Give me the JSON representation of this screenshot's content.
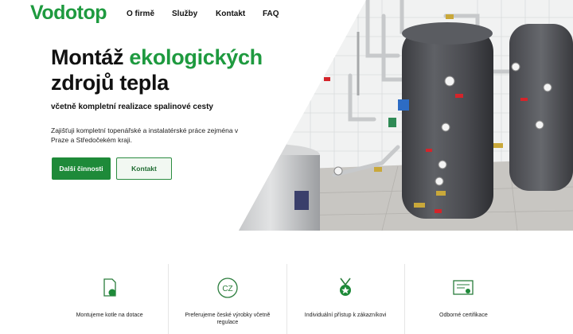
{
  "header": {
    "logo": "Vodotop",
    "nav": [
      "O firmě",
      "Služby",
      "Kontakt",
      "FAQ"
    ]
  },
  "hero": {
    "title_part1": "Montáž ",
    "title_accent": "ekologických",
    "title_part2": "zdrojů tepla",
    "subtitle": "včetně kompletní realizace spalinové cesty",
    "description": "Zajišťuji kompletní topenářské a instalatérské práce zejména v Praze a Středočekém kraji.",
    "primary_button": "Další činnosti",
    "secondary_button": "Kontakt"
  },
  "features": [
    {
      "label": "Montujeme kotle na dotace",
      "icon": "document-icon"
    },
    {
      "label": "Preferujeme české výrobky včetně regulace",
      "icon": "cz-badge-icon"
    },
    {
      "label": "Individuální přístup k zákazníkovi",
      "icon": "medal-icon"
    },
    {
      "label": "Odborné certifikace",
      "icon": "certificate-icon"
    }
  ],
  "colors": {
    "brand": "#1e9a3f",
    "button": "#1e8a39"
  }
}
